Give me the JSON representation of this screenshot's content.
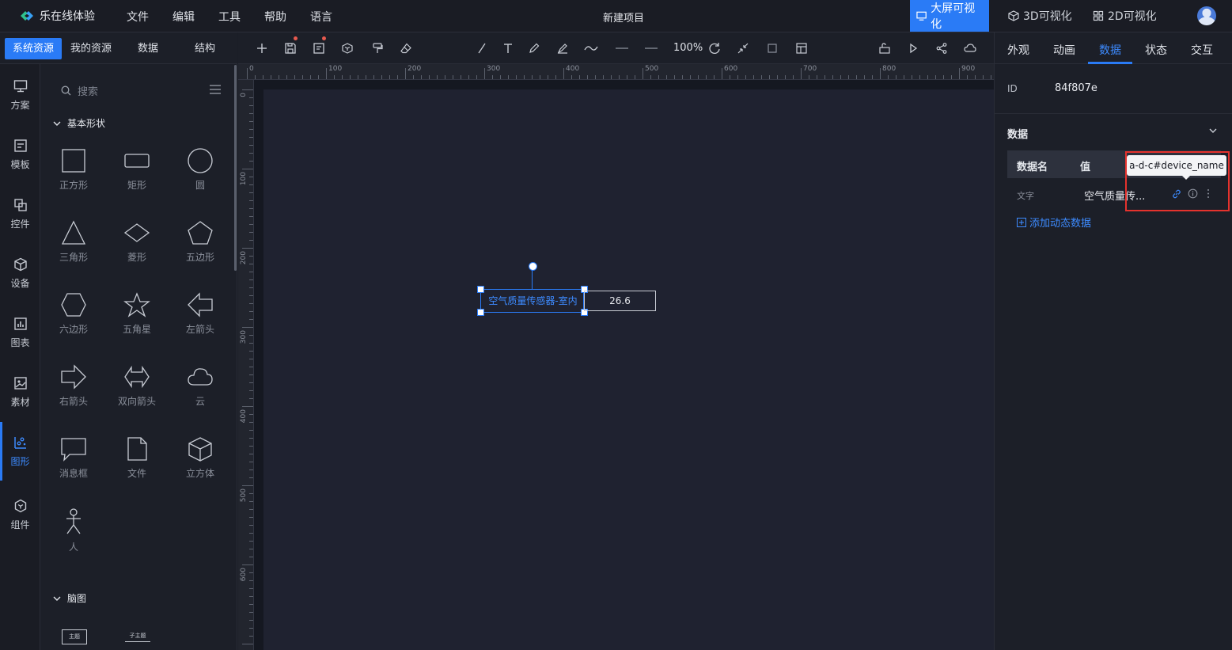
{
  "app": {
    "logo_text": "乐在线体验",
    "project_title": "新建项目"
  },
  "menu": [
    "文件",
    "编辑",
    "工具",
    "帮助",
    "语言"
  ],
  "modes": [
    {
      "label": "大屏可视化",
      "active": true
    },
    {
      "label": "3D可视化",
      "active": false
    },
    {
      "label": "2D可视化",
      "active": false
    }
  ],
  "resource_tabs": [
    "系统资源",
    "我的资源",
    "数据",
    "结构"
  ],
  "rail": [
    {
      "label": "方案",
      "icon": "monitor-icon"
    },
    {
      "label": "模板",
      "icon": "template-icon"
    },
    {
      "label": "控件",
      "icon": "widget-icon"
    },
    {
      "label": "设备",
      "icon": "cube-icon"
    },
    {
      "label": "图表",
      "icon": "chart-icon"
    },
    {
      "label": "素材",
      "icon": "image-icon"
    },
    {
      "label": "图形",
      "icon": "shape-icon",
      "active": true
    },
    {
      "label": "组件",
      "icon": "component-icon"
    }
  ],
  "shapes_panel": {
    "search_placeholder": "搜索",
    "section_basic": "基本形状",
    "section_mindmap": "脑图",
    "shapes": [
      {
        "label": "正方形",
        "icon": "square"
      },
      {
        "label": "矩形",
        "icon": "rect"
      },
      {
        "label": "圆",
        "icon": "circle"
      },
      {
        "label": "三角形",
        "icon": "triangle"
      },
      {
        "label": "菱形",
        "icon": "diamond"
      },
      {
        "label": "五边形",
        "icon": "pentagon"
      },
      {
        "label": "六边形",
        "icon": "hexagon"
      },
      {
        "label": "五角星",
        "icon": "star"
      },
      {
        "label": "左箭头",
        "icon": "arrow-left"
      },
      {
        "label": "右箭头",
        "icon": "arrow-right"
      },
      {
        "label": "双向箭头",
        "icon": "arrow-double"
      },
      {
        "label": "云",
        "icon": "cloud"
      },
      {
        "label": "消息框",
        "icon": "message"
      },
      {
        "label": "文件",
        "icon": "file"
      },
      {
        "label": "立方体",
        "icon": "cube"
      },
      {
        "label": "人",
        "icon": "person"
      }
    ],
    "mindmap_items": [
      "主题",
      "子主题"
    ]
  },
  "toolbar": {
    "zoom": "100%"
  },
  "ruler": {
    "h_ticks": [
      "0",
      "100",
      "200",
      "300",
      "400",
      "500",
      "600",
      "700",
      "800",
      "900"
    ],
    "v_ticks": [
      "0",
      "100",
      "200",
      "300",
      "400",
      "500",
      "600"
    ]
  },
  "canvas": {
    "selected_text": "空气质量传感器-室内",
    "value_text": "26.6"
  },
  "right_panel": {
    "tabs": [
      "外观",
      "动画",
      "数据",
      "状态",
      "交互"
    ],
    "active_tab": "数据",
    "id_label": "ID",
    "id_value": "84f807e",
    "data_section": "数据",
    "col_name": "数据名",
    "col_value": "值",
    "row_label": "文字",
    "row_value": "空气质量传...",
    "tooltip": "a-d-c#device_name",
    "add_dynamic": "添加动态数据"
  },
  "colors": {
    "accent": "#2a7bf6",
    "highlight_box": "#e5322d"
  }
}
